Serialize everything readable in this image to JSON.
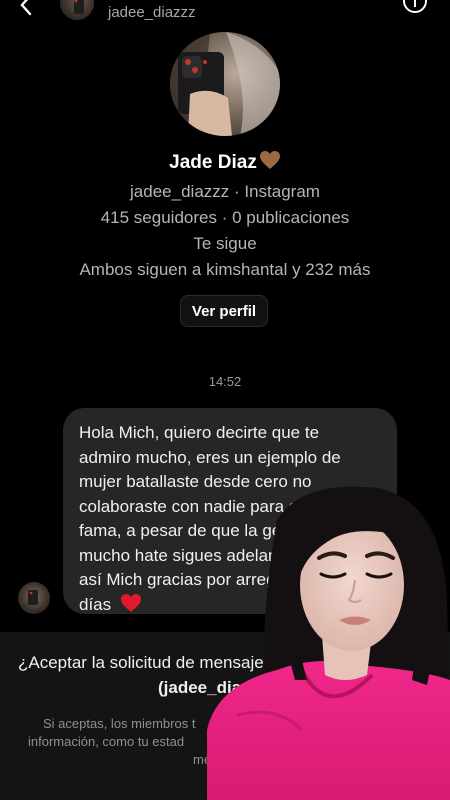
{
  "header": {
    "username": "jadee_diazzz"
  },
  "profile": {
    "name": "Jade Diaz",
    "name_emoji": "brown-heart-icon",
    "handle_line": "jadee_diazzz · Instagram",
    "stats_line": "415 seguidores · 0 publicaciones",
    "follows_you": "Te sigue",
    "mutuals": "Ambos siguen a kimshantal y 232 más",
    "view_profile": "Ver perfil"
  },
  "chat": {
    "timestamp": "14:52",
    "message_lines": [
      "Hola Mich, quiero decirte que te",
      "admiro mucho, eres un ejemplo de",
      "mujer batallaste desde cero no",
      "colaboraste con nadie para ganar",
      "fama, a pesar de que la gente te",
      "mucho hate sigues adelante",
      "así Mich gracias por arregla",
      "días"
    ],
    "message_emoji": "red-heart-icon"
  },
  "request": {
    "question": "¿Aceptar la solicitud de mensaje",
    "username": "(jadee_diazzz",
    "notice_lines": [
      "Si aceptas, los miembros t",
      "información, como tu estad",
      "me"
    ]
  },
  "colors": {
    "background": "#000000",
    "bubble": "#262626",
    "request_panel": "#141414",
    "overlay_hoodie": "#e8207e"
  }
}
